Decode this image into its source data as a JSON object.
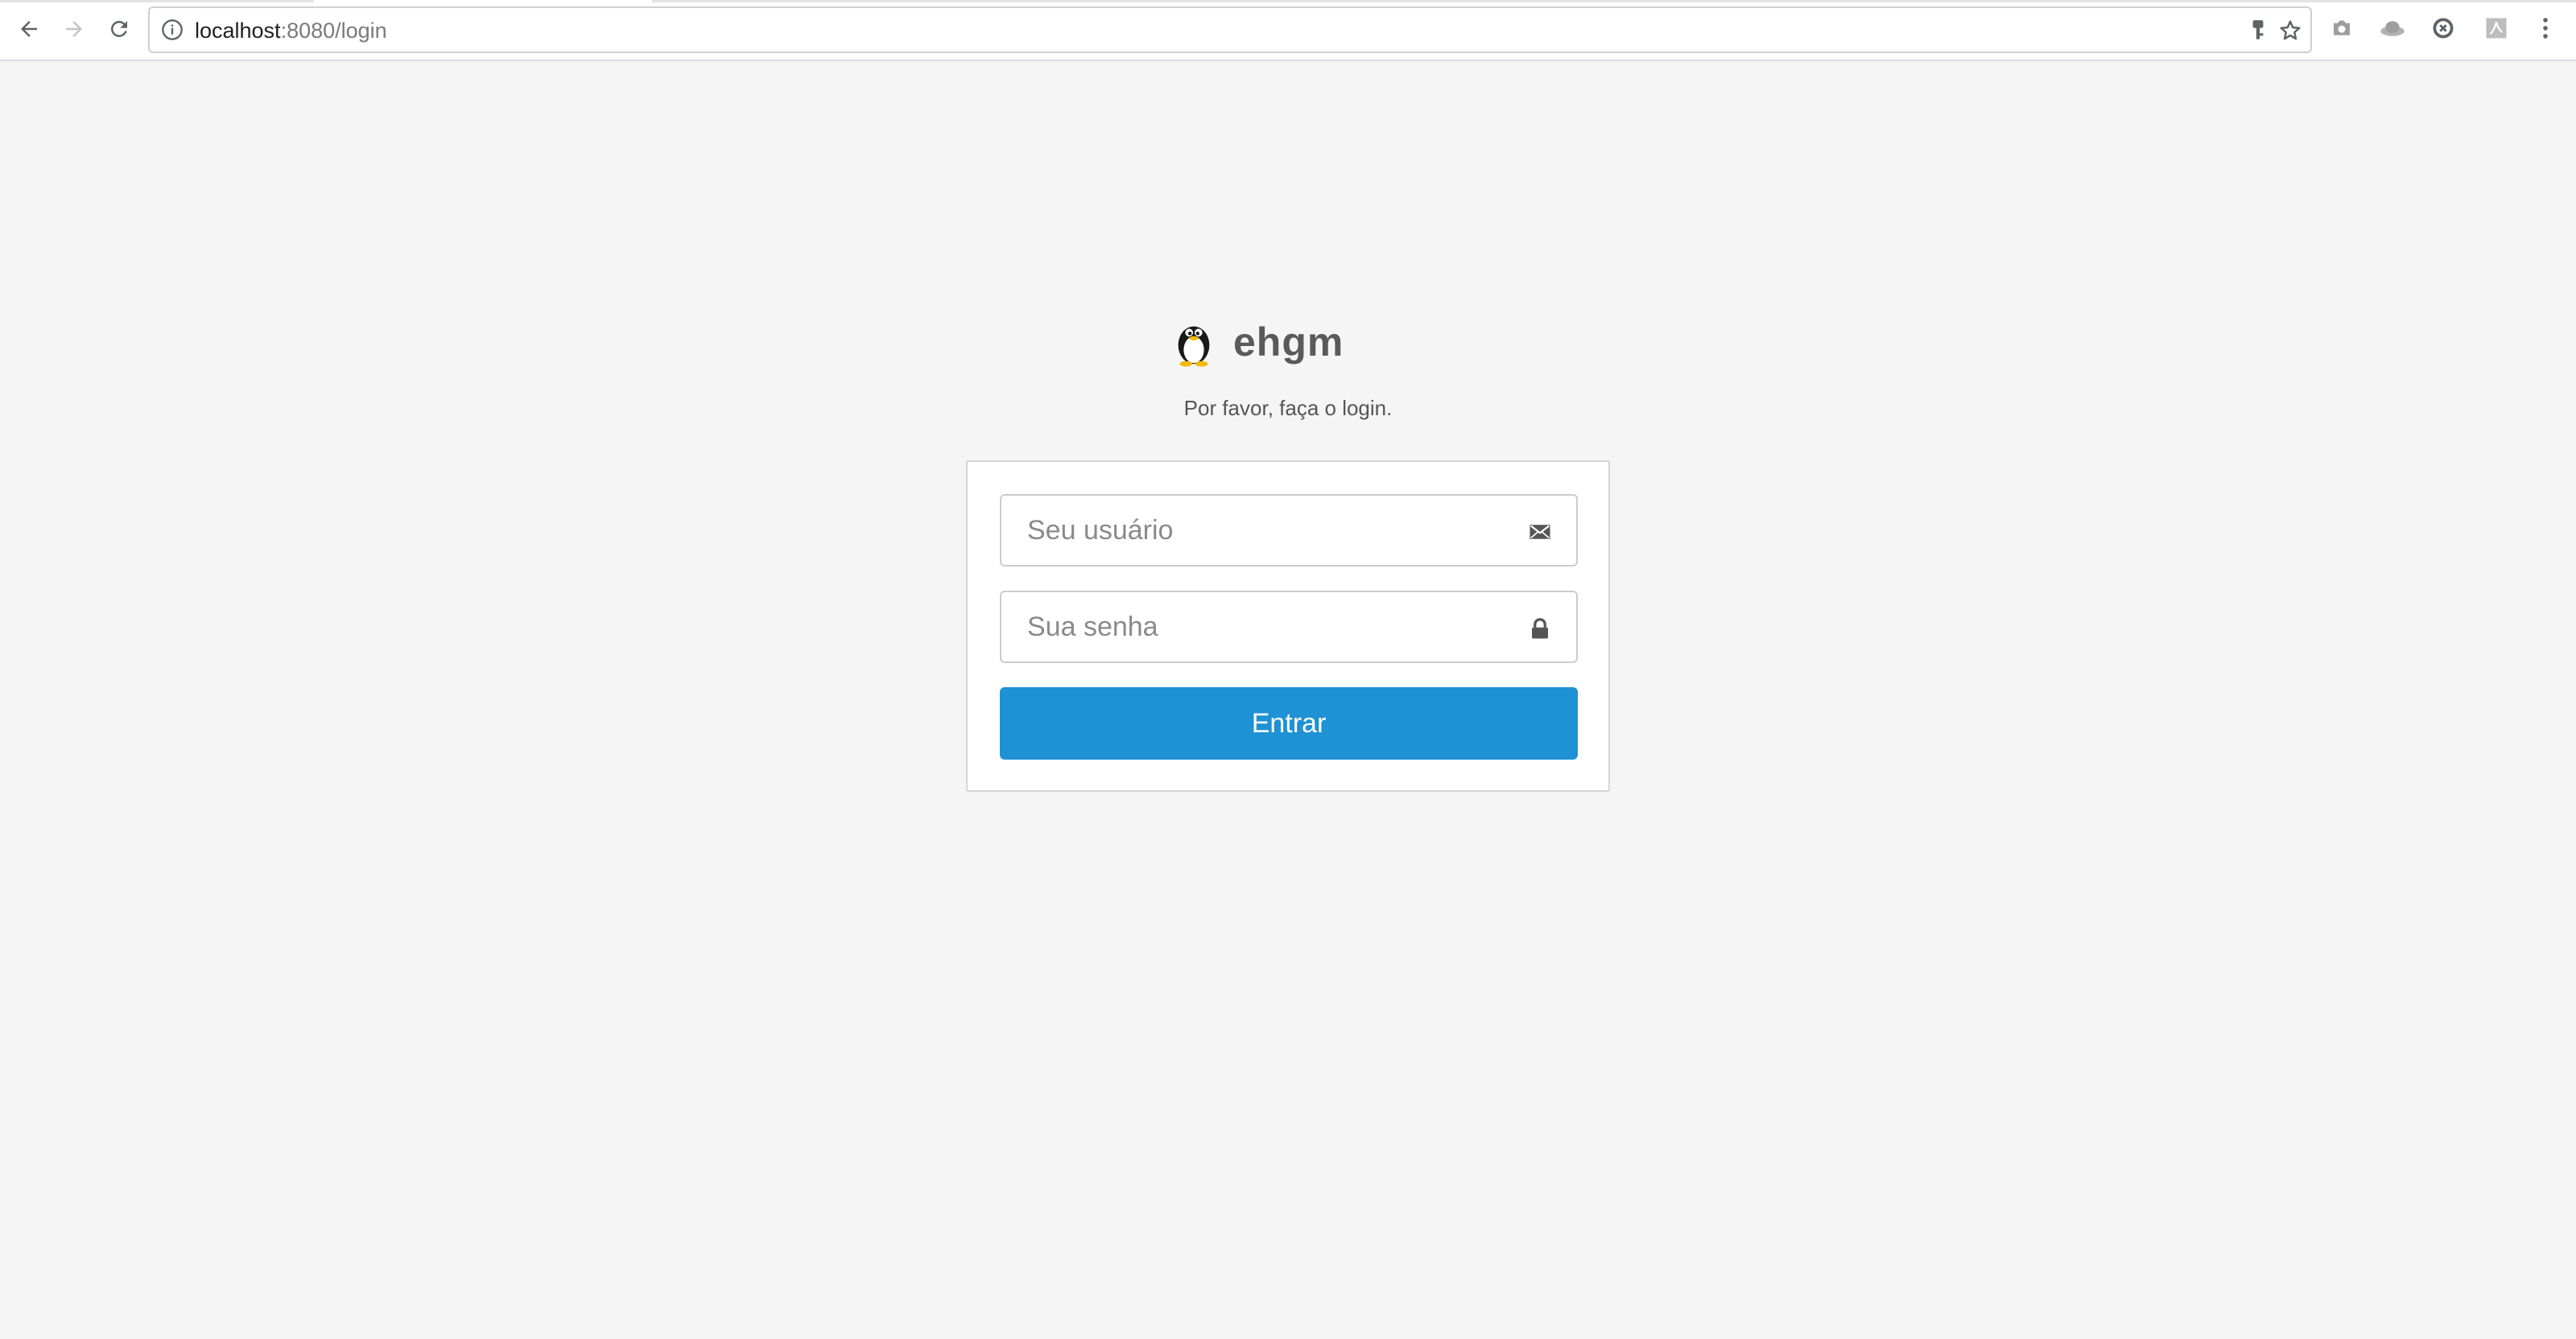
{
  "browser": {
    "url_host": "localhost",
    "url_rest": ":8080/login",
    "icons": {
      "back": "arrow-left-icon",
      "forward": "arrow-right-icon",
      "reload": "reload-icon",
      "site_info": "info-icon",
      "key": "key-icon",
      "bookmark": "star-icon",
      "extensions": [
        "camera-icon",
        "hat-icon",
        "sync-icon",
        "pdf-icon"
      ],
      "menu": "kebab-menu-icon"
    }
  },
  "page": {
    "brand_name": "ehgm",
    "subtitle": "Por favor, faça o login."
  },
  "login_form": {
    "username_placeholder": "Seu usuário",
    "username_icon": "envelope-icon",
    "password_placeholder": "Sua senha",
    "password_icon": "lock-icon",
    "submit_label": "Entrar"
  },
  "colors": {
    "background": "#f5f5f5",
    "button": "#1e92d4",
    "brand_text": "#5a5a5a"
  }
}
